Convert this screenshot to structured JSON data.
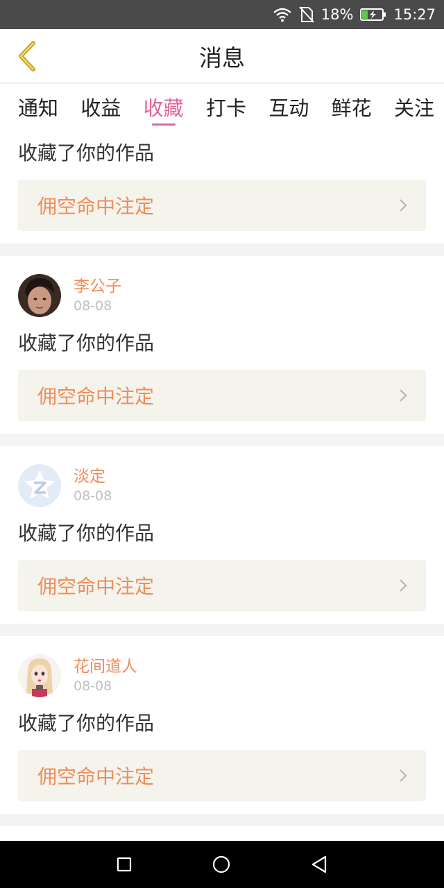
{
  "status_bar": {
    "battery": "18%",
    "time": "15:27"
  },
  "header": {
    "title": "消息"
  },
  "tabs": [
    {
      "label": "通知"
    },
    {
      "label": "收益"
    },
    {
      "label": "收藏",
      "active": true
    },
    {
      "label": "打卡"
    },
    {
      "label": "互动"
    },
    {
      "label": "鲜花"
    },
    {
      "label": "关注"
    }
  ],
  "items": [
    {
      "action": "收藏了你的作品",
      "work_title": "佣空命中注定"
    },
    {
      "user_name": "李公子",
      "date": "08-08",
      "action": "收藏了你的作品",
      "work_title": "佣空命中注定"
    },
    {
      "user_name": "淡定",
      "date": "08-08",
      "action": "收藏了你的作品",
      "work_title": "佣空命中注定"
    },
    {
      "user_name": "花间道人",
      "date": "08-08",
      "action": "收藏了你的作品",
      "work_title": "佣空命中注定"
    }
  ],
  "colors": {
    "accent_pink": "#e0659a",
    "accent_orange": "#ef8d5a",
    "back_arrow": "#c9a227"
  },
  "icons": {
    "back": "chevron-left-icon",
    "wifi": "wifi-icon",
    "no_sim": "no-sim-icon",
    "battery": "battery-charging-icon",
    "nav_recent": "square-icon",
    "nav_home": "circle-icon",
    "nav_back": "triangle-back-icon"
  }
}
